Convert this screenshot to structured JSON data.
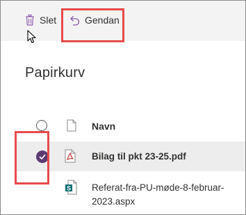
{
  "toolbar": {
    "delete_label": "Slet",
    "restore_label": "Gendan"
  },
  "page": {
    "title": "Papirkurv"
  },
  "list": {
    "column_name": "Navn",
    "rows": [
      {
        "name": "Bilag til pkt 23-25.pdf",
        "selected": true,
        "icon": "pdf-file-icon"
      },
      {
        "name_line1": "Referat-fra-PU-møde-8-februar-",
        "name_line2": "2023.aspx",
        "selected": false,
        "icon": "sharepoint-page-icon"
      }
    ]
  },
  "colors": {
    "accent": "#5c3c70",
    "highlight": "#e84a4a",
    "command_bar_bg": "#f3f3f3",
    "selected_row_bg": "#ededed"
  }
}
